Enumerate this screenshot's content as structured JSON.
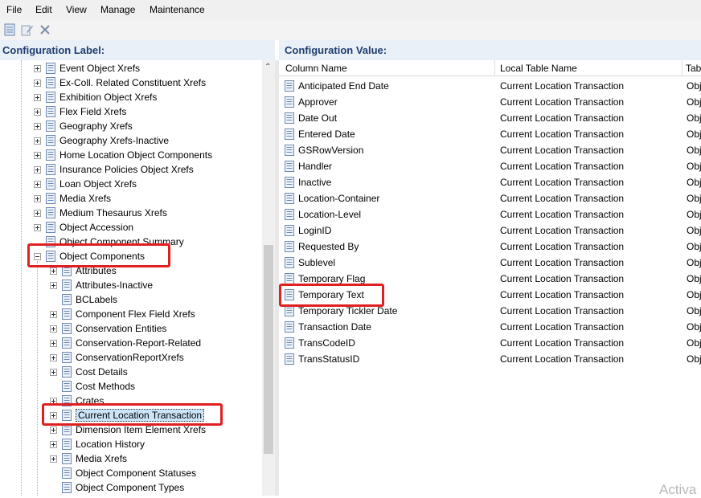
{
  "menu": [
    "File",
    "Edit",
    "View",
    "Manage",
    "Maintenance"
  ],
  "toolbar": {
    "icons": [
      "document-list-icon",
      "edit-pen-icon",
      "delete-x-icon"
    ]
  },
  "left_panel": {
    "title": "Configuration Label:",
    "tree": [
      {
        "label": "Event Object Xrefs",
        "level": 1,
        "expander": "plus"
      },
      {
        "label": "Ex-Coll. Related Constituent Xrefs",
        "level": 1,
        "expander": "plus"
      },
      {
        "label": "Exhibition Object Xrefs",
        "level": 1,
        "expander": "plus"
      },
      {
        "label": "Flex Field Xrefs",
        "level": 1,
        "expander": "plus"
      },
      {
        "label": "Geography Xrefs",
        "level": 1,
        "expander": "plus"
      },
      {
        "label": "Geography Xrefs-Inactive",
        "level": 1,
        "expander": "plus"
      },
      {
        "label": "Home Location Object Components",
        "level": 1,
        "expander": "plus"
      },
      {
        "label": "Insurance Policies Object Xrefs",
        "level": 1,
        "expander": "plus"
      },
      {
        "label": "Loan Object Xrefs",
        "level": 1,
        "expander": "plus"
      },
      {
        "label": "Media Xrefs",
        "level": 1,
        "expander": "plus"
      },
      {
        "label": "Medium Thesaurus Xrefs",
        "level": 1,
        "expander": "plus"
      },
      {
        "label": "Object Accession",
        "level": 1,
        "expander": "plus"
      },
      {
        "label": "Object Component Summary",
        "level": 1,
        "expander": "none"
      },
      {
        "label": "Object Components",
        "level": 1,
        "expander": "minus"
      },
      {
        "label": "Attributes",
        "level": 2,
        "expander": "plus"
      },
      {
        "label": "Attributes-Inactive",
        "level": 2,
        "expander": "plus"
      },
      {
        "label": "BCLabels",
        "level": 2,
        "expander": "none"
      },
      {
        "label": "Component Flex Field Xrefs",
        "level": 2,
        "expander": "plus"
      },
      {
        "label": "Conservation Entities",
        "level": 2,
        "expander": "plus"
      },
      {
        "label": "Conservation-Report-Related",
        "level": 2,
        "expander": "plus"
      },
      {
        "label": "ConservationReportXrefs",
        "level": 2,
        "expander": "plus"
      },
      {
        "label": "Cost Details",
        "level": 2,
        "expander": "plus"
      },
      {
        "label": "Cost Methods",
        "level": 2,
        "expander": "none"
      },
      {
        "label": "Crates",
        "level": 2,
        "expander": "plus"
      },
      {
        "label": "Current Location Transaction",
        "level": 2,
        "expander": "plus",
        "selected": true
      },
      {
        "label": "Dimension Item Element Xrefs",
        "level": 2,
        "expander": "plus"
      },
      {
        "label": "Location History",
        "level": 2,
        "expander": "plus"
      },
      {
        "label": "Media Xrefs",
        "level": 2,
        "expander": "plus"
      },
      {
        "label": "Object Component Statuses",
        "level": 2,
        "expander": "none"
      },
      {
        "label": "Object Component Types",
        "level": 2,
        "expander": "none"
      }
    ]
  },
  "right_panel": {
    "title": "Configuration Value:",
    "columns": [
      "Column Name",
      "Local Table Name",
      "Tab"
    ],
    "rows": [
      [
        "Anticipated End Date",
        "Current Location Transaction",
        "Obj"
      ],
      [
        "Approver",
        "Current Location Transaction",
        "Obj"
      ],
      [
        "Date Out",
        "Current Location Transaction",
        "Obj"
      ],
      [
        "Entered Date",
        "Current Location Transaction",
        "Obj"
      ],
      [
        "GSRowVersion",
        "Current Location Transaction",
        "Obj"
      ],
      [
        "Handler",
        "Current Location Transaction",
        "Obj"
      ],
      [
        "Inactive",
        "Current Location Transaction",
        "Obj"
      ],
      [
        "Location-Container",
        "Current Location Transaction",
        "Obj"
      ],
      [
        "Location-Level",
        "Current Location Transaction",
        "Obj"
      ],
      [
        "LoginID",
        "Current Location Transaction",
        "Obj"
      ],
      [
        "Requested By",
        "Current Location Transaction",
        "Obj"
      ],
      [
        "Sublevel",
        "Current Location Transaction",
        "Obj"
      ],
      [
        "Temporary Flag",
        "Current Location Transaction",
        "Obj"
      ],
      [
        "Temporary Text",
        "Current Location Transaction",
        "Obj"
      ],
      [
        "Temporary Tickler Date",
        "Current Location Transaction",
        "Obj"
      ],
      [
        "Transaction Date",
        "Current Location Transaction",
        "Obj"
      ],
      [
        "TransCodeID",
        "Current Location Transaction",
        "Obj"
      ],
      [
        "TransStatusID",
        "Current Location Transaction",
        "Obj"
      ]
    ]
  },
  "watermark": "Activa",
  "colors": {
    "header_text": "#1e3d6e",
    "highlight": "#e02020",
    "selection": "#cce4f7"
  }
}
